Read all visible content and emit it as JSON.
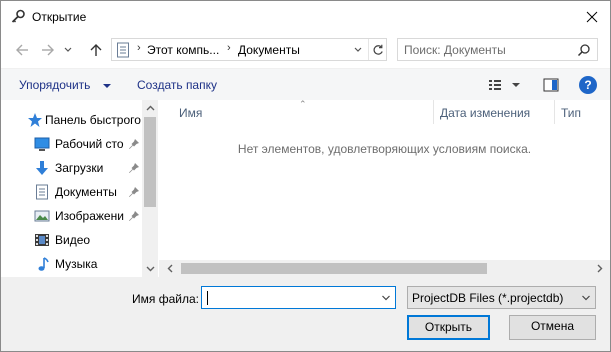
{
  "window": {
    "title": "Открытие"
  },
  "address": {
    "crumbs": [
      "Этот компь...",
      "Документы"
    ]
  },
  "search": {
    "placeholder": "Поиск: Документы"
  },
  "toolbar": {
    "organize_label": "Упорядочить",
    "new_folder_label": "Создать папку",
    "help_label": "?"
  },
  "sidebar": {
    "items": [
      {
        "label": "Панель быстрого",
        "icon": "star-icon",
        "pinned": false
      },
      {
        "label": "Рабочий сто",
        "icon": "desktop-icon",
        "pinned": true
      },
      {
        "label": "Загрузки",
        "icon": "download-icon",
        "pinned": true
      },
      {
        "label": "Документы",
        "icon": "document-icon",
        "pinned": true
      },
      {
        "label": "Изображени",
        "icon": "pictures-icon",
        "pinned": true
      },
      {
        "label": "Видео",
        "icon": "video-icon",
        "pinned": false
      },
      {
        "label": "Музыка",
        "icon": "music-icon",
        "pinned": false
      }
    ]
  },
  "filelist": {
    "columns": [
      "Имя",
      "Дата изменения",
      "Тип"
    ],
    "empty_message": "Нет элементов, удовлетворяющих условиям поиска."
  },
  "footer": {
    "filename_label": "Имя файла:",
    "filename_value": "",
    "filter_value": "ProjectDB Files (*.projectdb)",
    "open_label": "Открыть",
    "cancel_label": "Отмена"
  },
  "colors": {
    "accent": "#0078d7",
    "command_text": "#1e3287",
    "help_blue": "#1e66c8"
  }
}
